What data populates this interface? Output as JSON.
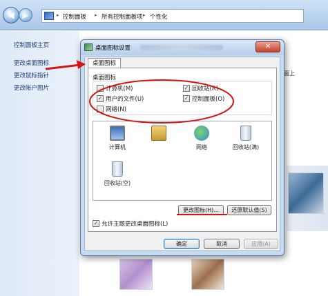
{
  "window": {
    "nav_back": "◀",
    "nav_forward": "▶",
    "breadcrumb": [
      "控制面板",
      "所有控制面板项",
      "个性化"
    ],
    "breadcrumb_sep": "▸",
    "sidebar_links": [
      "控制面板主页",
      "更改桌面图标",
      "更改鼠标指针",
      "更改帐户图片"
    ],
    "content_hint": "面上"
  },
  "dialog": {
    "title": "桌面图标设置",
    "close": "✕",
    "tab": "桌面图标",
    "group_label": "桌面图标",
    "checkboxes": [
      {
        "label": "计算机(M)",
        "checked": false
      },
      {
        "label": "回收站(R)",
        "checked": true
      },
      {
        "label": "用户的文件(U)",
        "checked": true
      },
      {
        "label": "控制面板(O)",
        "checked": true
      },
      {
        "label": "网络(N)",
        "checked": false
      }
    ],
    "icons": [
      "计算机",
      "",
      "网络",
      "回收站(满)",
      "回收站(空)"
    ],
    "change_icon": "更改图标(H)...",
    "restore_default": "还原默认值(S)",
    "allow_theme": {
      "label": "允许主题更改桌面图标(L)",
      "checked": true
    },
    "ok": "确定",
    "cancel": "取消",
    "apply": "应用(A)"
  },
  "colors": {
    "annotation_red": "#d41515"
  }
}
